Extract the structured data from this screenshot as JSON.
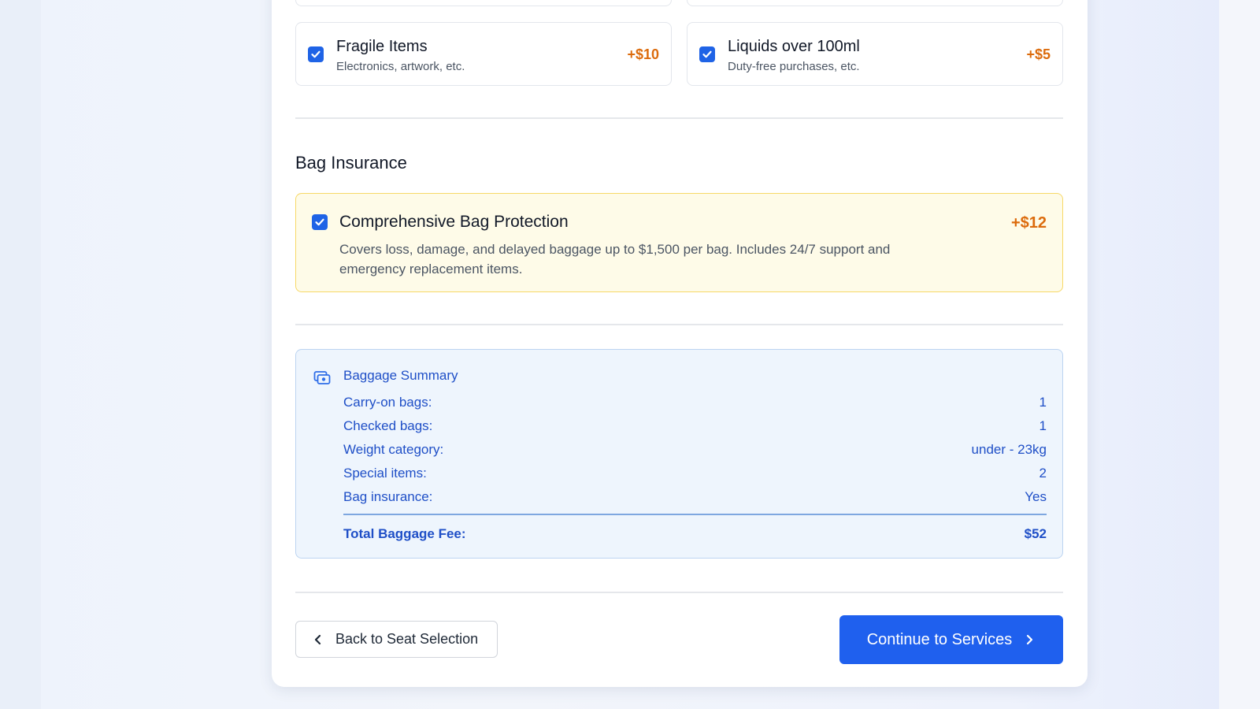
{
  "special_items": {
    "options": [
      {
        "title": "Fragile Items",
        "description": "Electronics, artwork, etc.",
        "price": "+$10",
        "checked": true
      },
      {
        "title": "Liquids over 100ml",
        "description": "Duty-free purchases, etc.",
        "price": "+$5",
        "checked": true
      }
    ]
  },
  "insurance": {
    "section_title": "Bag Insurance",
    "title": "Comprehensive Bag Protection",
    "description": "Covers loss, damage, and delayed baggage up to $1,500 per bag. Includes 24/7 support and emergency replacement items.",
    "price": "+$12",
    "checked": true
  },
  "summary": {
    "title": "Baggage Summary",
    "icon": "wallet-icon",
    "rows": [
      {
        "label": "Carry-on bags:",
        "value": "1"
      },
      {
        "label": "Checked bags:",
        "value": "1"
      },
      {
        "label": "Weight category:",
        "value": "under - 23kg"
      },
      {
        "label": "Special items:",
        "value": "2"
      },
      {
        "label": "Bag insurance:",
        "value": "Yes"
      }
    ],
    "total_label": "Total Baggage Fee:",
    "total_value": "$52"
  },
  "actions": {
    "back_label": "Back to Seat Selection",
    "continue_label": "Continue to Services"
  },
  "colors": {
    "accent": "#1f60ee",
    "price": "#dc6b0c",
    "insurance_bg": "#fefbe8",
    "summary_bg": "#eef5fd",
    "summary_text": "#1f4fc7"
  }
}
